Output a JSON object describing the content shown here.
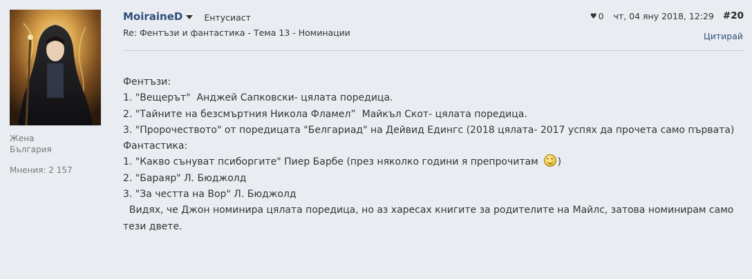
{
  "author": {
    "username": "MoiraineD",
    "rank": "Ентусиаст",
    "gender": "Жена",
    "country": "България",
    "posts_label": "Мнения: 2 157"
  },
  "post": {
    "likes": "0",
    "date": "чт, 04 яну 2018, 12:29",
    "number": "#20",
    "title": "Re: Фентъзи и фантастика - Тема 13 - Номинации",
    "quote_label": "Цитирай"
  },
  "content": {
    "lines": [
      "Фентъзи:",
      "1. \"Вещерът\"  Анджей Сапковски- цялата поредица.",
      "2. \"Тайните на безсмъртния Никола Фламел”  Майкъл Скот- цялата поредица.",
      "3. \"Пророчеството\" от поредицата \"Белгариад\" на Дейвид Едингс (2018 цялата- 2017 успях да прочета само първата)",
      "Фантастика:"
    ],
    "smiley_line_text": "1. \"Какво сънуват псиборгите\" Пиер Барбе (през няколко години я препрочитам",
    "smiley_line_end": ")",
    "lines_after": [
      "2. \"Бараяр\" Л. Бюджолд",
      "3. \"За честта на Вор\" Л. Бюджолд"
    ],
    "closing": "  Видях, че Джон номинира цялата поредица, но аз харесах книгите за родителите на Майлс, затова номинирам само тези двете."
  },
  "icons": {
    "heart": "heart-icon",
    "caret": "chevron-down-icon",
    "smiley": "smiley-icon"
  },
  "colors": {
    "background": "#e9ecf1",
    "username": "#2d4d7a",
    "link": "#2d4d7a"
  }
}
